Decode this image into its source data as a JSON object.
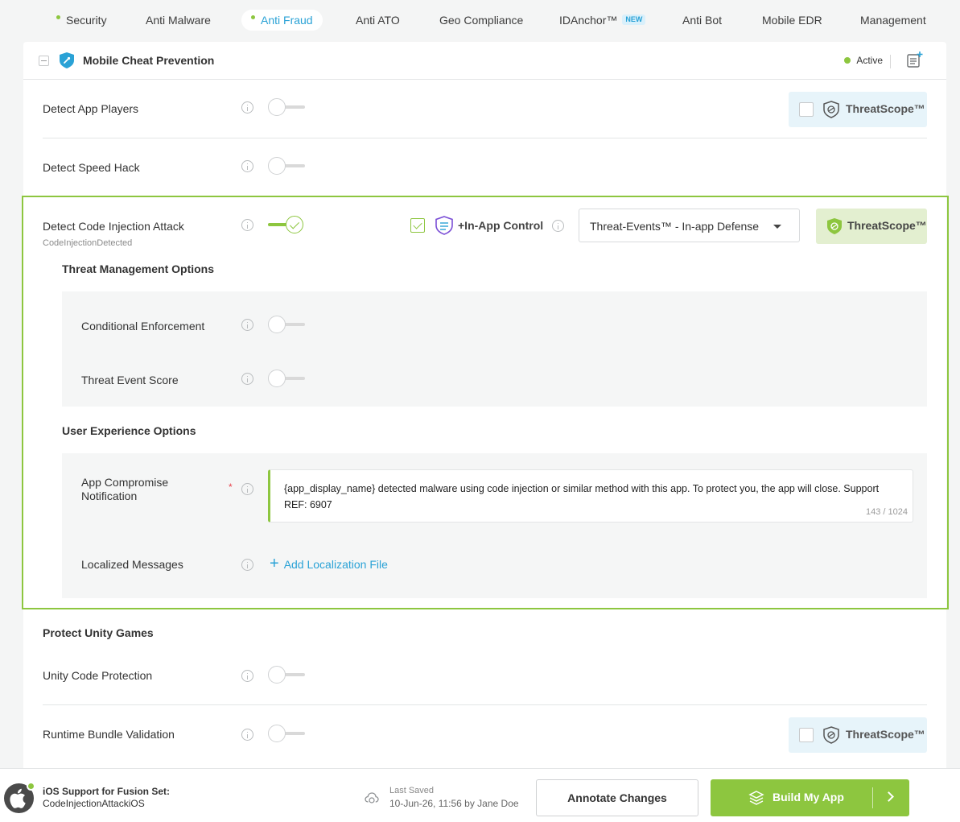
{
  "tabs": [
    {
      "label": "Security",
      "dot": true
    },
    {
      "label": "Anti Malware"
    },
    {
      "label": "Anti Fraud",
      "dot": true,
      "active": true
    },
    {
      "label": "Anti ATO"
    },
    {
      "label": "Geo Compliance"
    },
    {
      "label": "IDAnchor™",
      "badge": "NEW"
    },
    {
      "label": "Anti Bot"
    },
    {
      "label": "Mobile EDR"
    },
    {
      "label": "Management"
    }
  ],
  "panel": {
    "title": "Mobile Cheat Prevention",
    "status": "Active",
    "colors": {
      "accent": "#8dc63f",
      "link": "#2aa2d6",
      "threatscope_bg": "#e7f4fa"
    }
  },
  "rows": {
    "app_players": {
      "label": "Detect App Players",
      "toggle_on": false,
      "threatscope": "ThreatScope™"
    },
    "speed_hack": {
      "label": "Detect Speed Hack",
      "toggle_on": false
    },
    "code_injection": {
      "label": "Detect Code Injection Attack",
      "sub": "CodeInjectionDetected",
      "toggle_on": true,
      "in_app_control": "+In-App Control",
      "in_app_checked": true,
      "select_value": "Threat-Events™ - In-app Defense",
      "threatscope": "ThreatScope™",
      "threat_mgmt_title": "Threat Management Options",
      "conditional_enforcement": "Conditional Enforcement",
      "threat_event_score": "Threat Event Score",
      "ux_title": "User Experience Options",
      "notification_label": "App Compromise Notification",
      "notification_required": "*",
      "notification_text": "{app_display_name} detected malware using code injection or similar method with this app. To protect you, the app will close. Support REF: 6907",
      "notification_count": "143 / 1024",
      "localized_label": "Localized Messages",
      "add_localization": "Add Localization File"
    },
    "unity_title": "Protect Unity Games",
    "unity_code": {
      "label": "Unity Code Protection",
      "toggle_on": false
    },
    "runtime_bundle": {
      "label": "Runtime Bundle Validation",
      "toggle_on": false,
      "threatscope": "ThreatScope™"
    }
  },
  "footer": {
    "title": "iOS Support for Fusion Set:",
    "subtitle": "CodeInjectionAttackiOS",
    "saved_label": "Last Saved",
    "saved_value": "10-Jun-26, 11:56 by Jane Doe",
    "annotate_button": "Annotate Changes",
    "build_button": "Build My App"
  }
}
